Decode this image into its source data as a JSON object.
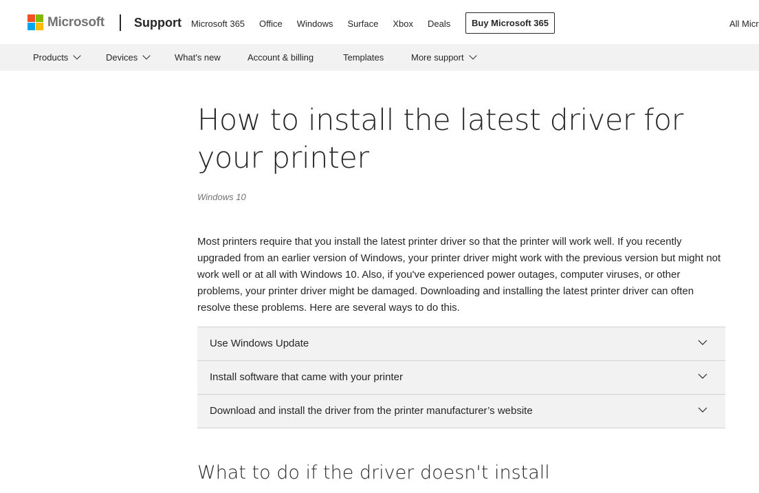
{
  "header": {
    "brand": "Microsoft",
    "logo_colors": [
      "#f25022",
      "#7fba00",
      "#00a4ef",
      "#ffb900"
    ],
    "support_label": "Support",
    "nav": [
      "Microsoft 365",
      "Office",
      "Windows",
      "Surface",
      "Xbox",
      "Deals"
    ],
    "buy_button": "Buy Microsoft 365",
    "all_microsoft": "All Micr"
  },
  "subnav": {
    "items": [
      {
        "label": "Products",
        "dropdown": true
      },
      {
        "label": "Devices",
        "dropdown": true
      },
      {
        "label": "What's new",
        "dropdown": false
      },
      {
        "label": "Account & billing",
        "dropdown": false
      },
      {
        "label": "Templates",
        "dropdown": false
      },
      {
        "label": "More support",
        "dropdown": true
      }
    ]
  },
  "article": {
    "title": "How to install the latest driver for your printer",
    "applies_to": "Windows 10",
    "intro": "Most printers require that you install the latest printer driver so that the printer will work well. If you recently upgraded from an earlier version of Windows, your printer driver might work with the previous version but might not work well or at all with Windows 10.  Also, if you've experienced power outages, computer viruses, or other problems, your printer driver might be damaged. Downloading and installing the latest printer driver can often resolve these problems. Here are several ways to do this.",
    "accordion": [
      {
        "label": "Use Windows Update",
        "icon": "chevron-down-icon"
      },
      {
        "label": "Install software that came with your printer",
        "icon": "chevron-down-icon"
      },
      {
        "label": "Download and install the driver from the printer manufacturer’s website",
        "icon": "chevron-down-icon"
      }
    ],
    "subheading": "What to do if the driver doesn't install"
  }
}
